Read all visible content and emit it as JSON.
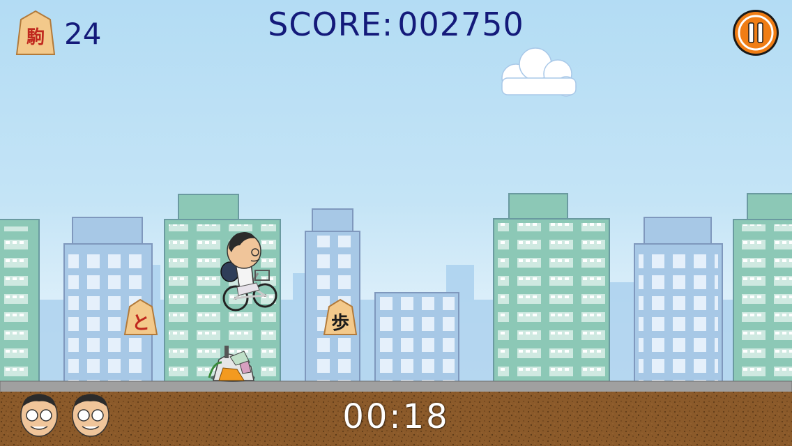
{
  "hud": {
    "koma_icon_char": "駒",
    "koma_count": "24",
    "score_label": "SCORE:",
    "score_value": "002750",
    "timer": "00:18",
    "lives_count": 2,
    "pause_icon": "pause-icon"
  },
  "pieces": [
    {
      "char": "と",
      "color": "#c0281e"
    },
    {
      "char": "歩",
      "color": "#1a1a1a"
    }
  ],
  "colors": {
    "score_text": "#141a7a",
    "timer_text": "#ffffff",
    "pause_button": "#f07d14",
    "ground": "#8a5a2b",
    "road": "#9a9a9a",
    "sky_top": "#b3dcf4"
  }
}
